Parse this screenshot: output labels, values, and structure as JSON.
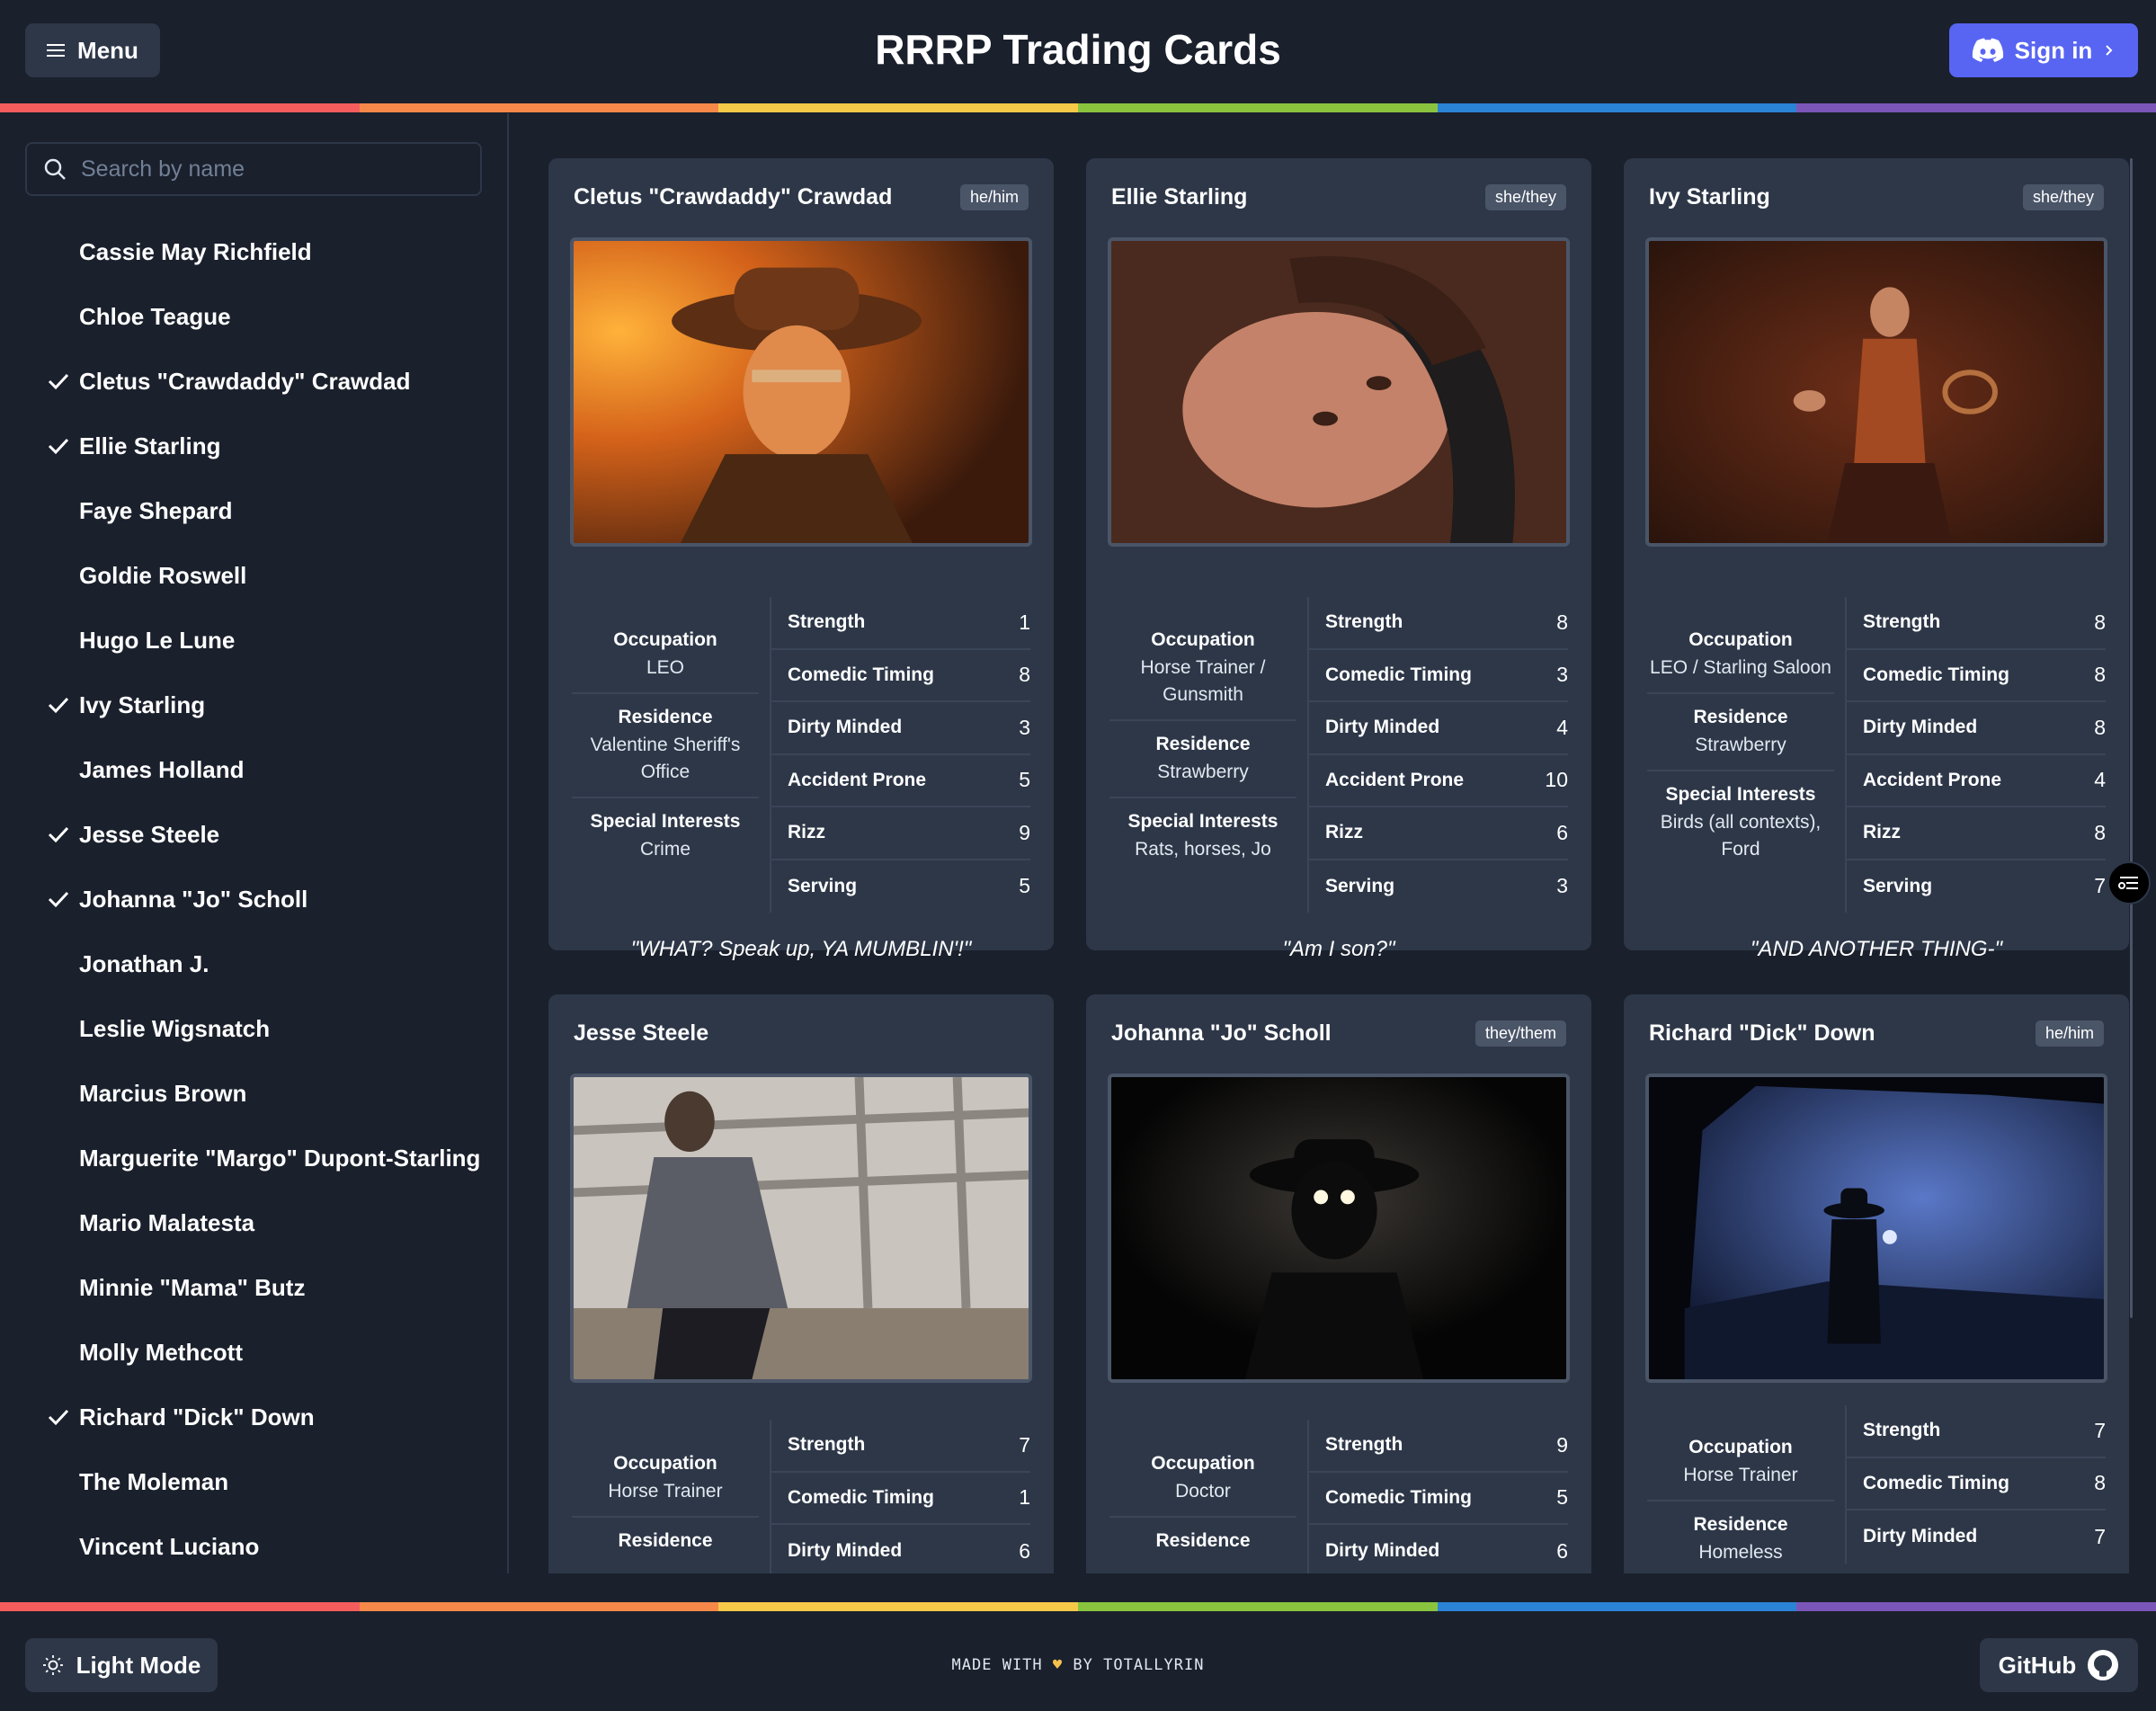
{
  "header": {
    "menu_label": "Menu",
    "title": "RRRP Trading Cards",
    "signin_label": "Sign in"
  },
  "rainbow_colors": [
    "#f55d5d",
    "#f6894a",
    "#f7c948",
    "#8ac43f",
    "#2b83d6",
    "#7b56b8"
  ],
  "search": {
    "placeholder": "Search by name"
  },
  "sidebar": {
    "names": [
      {
        "label": "Cassie May Richfield",
        "checked": false
      },
      {
        "label": "Chloe Teague",
        "checked": false
      },
      {
        "label": "Cletus \"Crawdaddy\" Crawdad",
        "checked": true
      },
      {
        "label": "Ellie Starling",
        "checked": true
      },
      {
        "label": "Faye Shepard",
        "checked": false
      },
      {
        "label": "Goldie Roswell",
        "checked": false
      },
      {
        "label": "Hugo Le Lune",
        "checked": false
      },
      {
        "label": "Ivy Starling",
        "checked": true
      },
      {
        "label": "James Holland",
        "checked": false
      },
      {
        "label": "Jesse Steele",
        "checked": true
      },
      {
        "label": "Johanna \"Jo\" Scholl",
        "checked": true
      },
      {
        "label": "Jonathan J.",
        "checked": false
      },
      {
        "label": "Leslie Wigsnatch",
        "checked": false
      },
      {
        "label": "Marcius Brown",
        "checked": false
      },
      {
        "label": "Marguerite \"Margo\" Dupont-Starling",
        "checked": false
      },
      {
        "label": "Mario Malatesta",
        "checked": false
      },
      {
        "label": "Minnie \"Mama\" Butz",
        "checked": false
      },
      {
        "label": "Molly Methcott",
        "checked": false
      },
      {
        "label": "Richard \"Dick\" Down",
        "checked": true
      },
      {
        "label": "The Moleman",
        "checked": false
      },
      {
        "label": "Vincent Luciano",
        "checked": false
      }
    ]
  },
  "cards": [
    {
      "name": "Cletus \"Crawdaddy\" Crawdad",
      "pronouns": "he/him",
      "image": "cowboy-portrait-fire",
      "info": [
        {
          "label": "Occupation",
          "value": "LEO"
        },
        {
          "label": "Residence",
          "value": "Valentine Sheriff's Office"
        },
        {
          "label": "Special Interests",
          "value": "Crime"
        }
      ],
      "stats": [
        {
          "name": "Strength",
          "value": "1"
        },
        {
          "name": "Comedic Timing",
          "value": "8"
        },
        {
          "name": "Dirty Minded",
          "value": "3"
        },
        {
          "name": "Accident Prone",
          "value": "5"
        },
        {
          "name": "Rizz",
          "value": "9"
        },
        {
          "name": "Serving",
          "value": "5"
        }
      ],
      "quote": "\"WHAT? Speak up, YA MUMBLIN'!\""
    },
    {
      "name": "Ellie Starling",
      "pronouns": "she/they",
      "image": "woman-lying-hat",
      "info": [
        {
          "label": "Occupation",
          "value": "Horse Trainer / Gunsmith"
        },
        {
          "label": "Residence",
          "value": "Strawberry"
        },
        {
          "label": "Special Interests",
          "value": "Rats, horses, Jo"
        }
      ],
      "stats": [
        {
          "name": "Strength",
          "value": "8"
        },
        {
          "name": "Comedic Timing",
          "value": "3"
        },
        {
          "name": "Dirty Minded",
          "value": "4"
        },
        {
          "name": "Accident Prone",
          "value": "10"
        },
        {
          "name": "Rizz",
          "value": "6"
        },
        {
          "name": "Serving",
          "value": "3"
        }
      ],
      "quote": "\"Am I son?\""
    },
    {
      "name": "Ivy Starling",
      "pronouns": "she/they",
      "image": "woman-basket-night",
      "info": [
        {
          "label": "Occupation",
          "value": "LEO / Starling Saloon"
        },
        {
          "label": "Residence",
          "value": "Strawberry"
        },
        {
          "label": "Special Interests",
          "value": "Birds (all contexts), Ford"
        }
      ],
      "stats": [
        {
          "name": "Strength",
          "value": "8"
        },
        {
          "name": "Comedic Timing",
          "value": "8"
        },
        {
          "name": "Dirty Minded",
          "value": "8"
        },
        {
          "name": "Accident Prone",
          "value": "4"
        },
        {
          "name": "Rizz",
          "value": "8"
        },
        {
          "name": "Serving",
          "value": "7"
        }
      ],
      "quote": "\"AND ANOTHER THING-\""
    },
    {
      "name": "Jesse Steele",
      "pronouns": "",
      "image": "blurry-running-man",
      "info": [
        {
          "label": "Occupation",
          "value": "Horse Trainer"
        },
        {
          "label": "Residence",
          "value": ""
        }
      ],
      "stats": [
        {
          "name": "Strength",
          "value": "7"
        },
        {
          "name": "Comedic Timing",
          "value": "1"
        },
        {
          "name": "Dirty Minded",
          "value": "6"
        }
      ],
      "quote": ""
    },
    {
      "name": "Johanna \"Jo\" Scholl",
      "pronouns": "they/them",
      "image": "silhouette-glowing-eyes",
      "info": [
        {
          "label": "Occupation",
          "value": "Doctor"
        },
        {
          "label": "Residence",
          "value": ""
        }
      ],
      "stats": [
        {
          "name": "Strength",
          "value": "9"
        },
        {
          "name": "Comedic Timing",
          "value": "5"
        },
        {
          "name": "Dirty Minded",
          "value": "6"
        }
      ],
      "quote": ""
    },
    {
      "name": "Richard \"Dick\" Down",
      "pronouns": "he/him",
      "image": "cowboy-blue-night",
      "info": [
        {
          "label": "Occupation",
          "value": "Horse Trainer"
        },
        {
          "label": "Residence",
          "value": "Homeless"
        }
      ],
      "stats": [
        {
          "name": "Strength",
          "value": "7"
        },
        {
          "name": "Comedic Timing",
          "value": "8"
        },
        {
          "name": "Dirty Minded",
          "value": "7"
        }
      ],
      "quote": ""
    }
  ],
  "footer": {
    "light_label": "Light Mode",
    "made_with_prefix": "MADE WITH",
    "made_with_suffix": "BY TOTALLYRIN",
    "github_label": "GitHub"
  }
}
